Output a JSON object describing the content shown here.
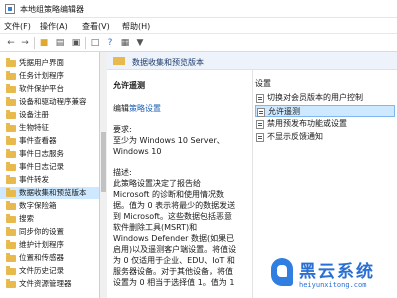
{
  "window": {
    "title": "本地组策略编辑器"
  },
  "menubar": {
    "items": [
      "文件(F)",
      "操作(A)",
      "查看(V)",
      "帮助(H)"
    ]
  },
  "toolbar": {
    "icons": [
      "back-arrow-icon",
      "forward-arrow-icon",
      "folder-up-icon",
      "show-tree-icon",
      "properties-icon",
      "export-icon",
      "help-icon",
      "show-pane-icon",
      "filter-icon"
    ]
  },
  "tree": {
    "items": [
      {
        "label": "凭据用户界面"
      },
      {
        "label": "任务计划程序"
      },
      {
        "label": "软件保护平台"
      },
      {
        "label": "设备和驱动程序兼容"
      },
      {
        "label": "设备注册"
      },
      {
        "label": "生物特征"
      },
      {
        "label": "事件查看器"
      },
      {
        "label": "事件日志服务"
      },
      {
        "label": "事件日志记录"
      },
      {
        "label": "事件转发"
      },
      {
        "label": "数据收集和预览版本",
        "selected": true
      },
      {
        "label": "数字保险箱"
      },
      {
        "label": "搜索"
      },
      {
        "label": "同步你的设置"
      },
      {
        "label": "维护计划程序"
      },
      {
        "label": "位置和传感器"
      },
      {
        "label": "文件历史记录"
      },
      {
        "label": "文件资源管理器"
      }
    ]
  },
  "panel": {
    "header": "数据收集和预览版本",
    "desc": {
      "policy_name": "允许遥测",
      "edit_prefix": "编辑",
      "edit_link": "策略设置",
      "req_label": "要求:",
      "req_line1": "至少为 Windows 10 Server、",
      "req_line2": "Windows 10",
      "desc_label": "描述:",
      "lines": [
        "此策略设置决定了报告给",
        "Microsoft 的诊断和使用情况数",
        "据。值为 0 表示将最少的数据发送",
        "到 Microsoft。这些数据包括恶意",
        "软件删除工具(MSRT)和",
        "Windows Defender 数据(如果已",
        "启用)以及遥测客户端设置。将值设",
        "为 0 仅适用于企业、EDU、IoT 和",
        "服务器设备。对于其他设备，将值",
        "设置为 0 相当于选择值 1。值为 1"
      ]
    },
    "settings": {
      "column_header": "设置",
      "items": [
        {
          "label": "切换对会员版本的用户控制"
        },
        {
          "label": "允许遥测",
          "selected": true
        },
        {
          "label": "禁用预发布功能或设置"
        },
        {
          "label": "不显示反馈通知"
        }
      ]
    }
  },
  "watermark": {
    "name": "黑云系统",
    "url": "heiyunxitong.com"
  }
}
